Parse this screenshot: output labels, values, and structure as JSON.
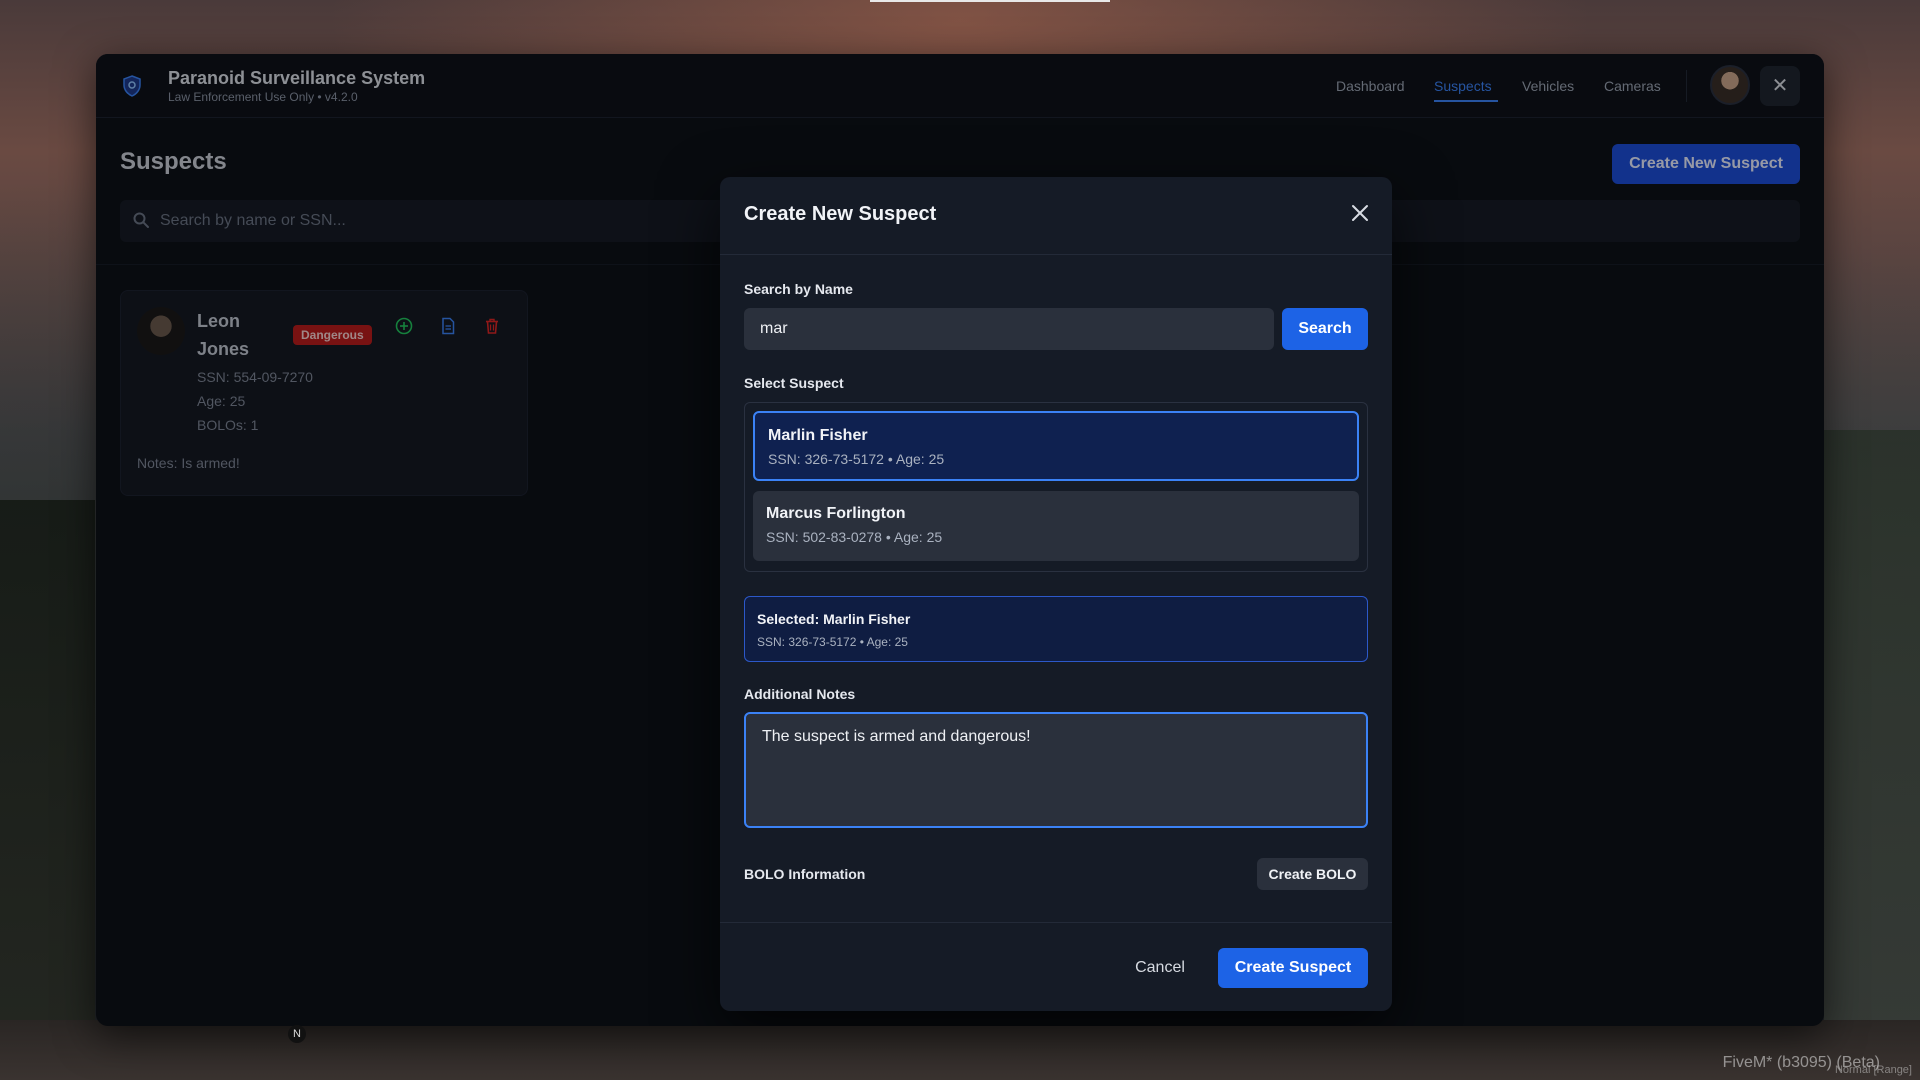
{
  "app": {
    "title": "Paranoid Surveillance System",
    "subtitle": "Law Enforcement Use Only • v4.2.0"
  },
  "nav": {
    "items": [
      {
        "label": "Dashboard",
        "active": false
      },
      {
        "label": "Suspects",
        "active": true
      },
      {
        "label": "Vehicles",
        "active": false
      },
      {
        "label": "Cameras",
        "active": false
      }
    ]
  },
  "page": {
    "title": "Suspects",
    "create_button": "Create New Suspect",
    "search_placeholder": "Search by name or SSN..."
  },
  "suspect_card": {
    "first_name": "Leon",
    "last_name": "Jones",
    "badge": "Dangerous",
    "ssn": "SSN: 554-09-7270",
    "age": "Age: 25",
    "bolos": "BOLOs: 1",
    "notes": "Notes: Is armed!"
  },
  "modal": {
    "title": "Create New Suspect",
    "search_label": "Search by Name",
    "search_value": "mar",
    "search_button": "Search",
    "select_label": "Select Suspect",
    "options": [
      {
        "name": "Marlin Fisher",
        "details": "SSN: 326-73-5172 • Age: 25",
        "selected": true
      },
      {
        "name": "Marcus Forlington",
        "details": "SSN: 502-83-0278 • Age: 25",
        "selected": false
      }
    ],
    "selected_title": "Selected: Marlin Fisher",
    "selected_details": "SSN: 326-73-5172 • Age: 25",
    "notes_label": "Additional Notes",
    "notes_value": "The suspect is armed and dangerous!",
    "bolo_label": "BOLO Information",
    "bolo_button": "Create BOLO",
    "cancel_button": "Cancel",
    "submit_button": "Create Suspect"
  },
  "overlay": {
    "compass": "N",
    "watermark": "FiveM* (b3095) (Beta)",
    "watermark_sub": "Normal [Range]"
  },
  "colors": {
    "accent": "#3b82f6",
    "primary_button": "#1d63e6",
    "danger": "#b91c1c",
    "success_icon": "#22c55e"
  }
}
